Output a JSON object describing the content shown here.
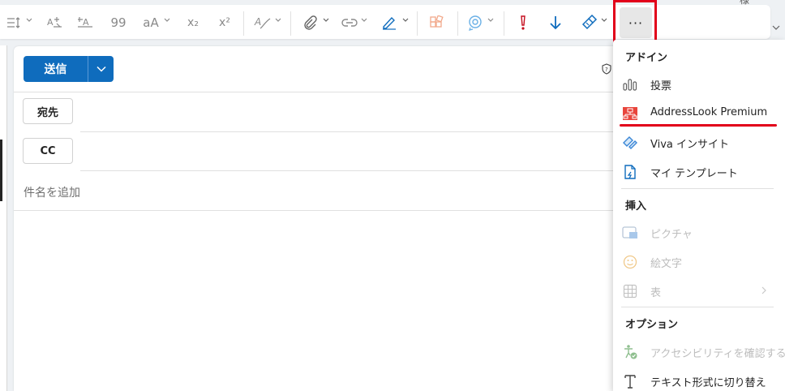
{
  "ribbon": {
    "tools": [
      {
        "name": "line-spacing-icon"
      },
      {
        "name": "increase-indent-icon"
      },
      {
        "name": "decrease-indent-icon"
      },
      {
        "name": "quote-icon",
        "glyph": "99"
      },
      {
        "name": "change-case-icon",
        "glyph": "aA"
      },
      {
        "name": "subscript-icon",
        "glyph": "x₂"
      },
      {
        "name": "superscript-icon",
        "glyph": "x²"
      },
      {
        "name": "styles-icon"
      },
      {
        "name": "attach-icon"
      },
      {
        "name": "link-icon"
      },
      {
        "name": "signature-icon"
      },
      {
        "name": "apps-icon"
      },
      {
        "name": "loop-icon"
      },
      {
        "name": "importance-high-icon"
      },
      {
        "name": "importance-low-icon"
      },
      {
        "name": "format-painter-icon"
      }
    ],
    "more_label": "···",
    "top_clip_text": "様"
  },
  "compose": {
    "send_label": "送信",
    "to_label": "宛先",
    "cc_label": "CC",
    "subject_placeholder": "件名を追加"
  },
  "menu": {
    "sections": {
      "addins": "アドイン",
      "insert": "挿入",
      "options": "オプション"
    },
    "items": {
      "polls": "投票",
      "addresslook": "AddressLook Premium",
      "viva": "Viva インサイト",
      "templates": "マイ テンプレート",
      "picture": "ピクチャ",
      "emoji": "絵文字",
      "table": "表",
      "accessibility": "アクセシビリティを確認する",
      "text_format": "テキスト形式に切り替え"
    }
  },
  "colors": {
    "accent_blue": "#0f6cbd",
    "highlight_red": "#e2001a",
    "importance_red": "#c50f1f"
  }
}
